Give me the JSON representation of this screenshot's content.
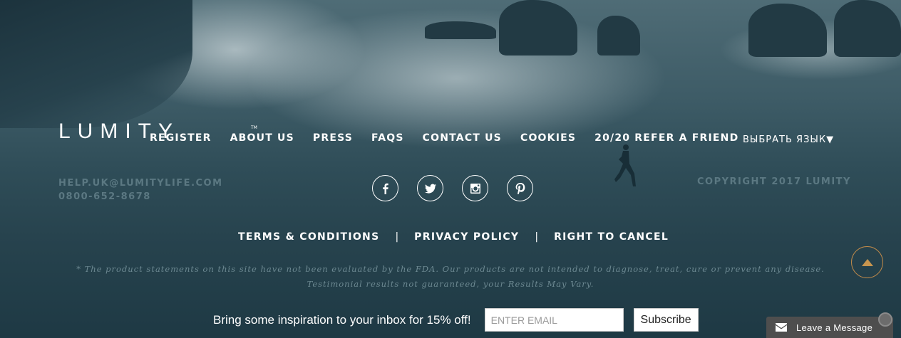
{
  "brand": {
    "logo_text": "LUMITY",
    "logo_tm": "TM"
  },
  "nav": {
    "items": [
      {
        "label": "REGISTER"
      },
      {
        "label": "ABOUT US"
      },
      {
        "label": "PRESS"
      },
      {
        "label": "FAQS"
      },
      {
        "label": "CONTACT US"
      },
      {
        "label": "COOKIES"
      },
      {
        "label": "20/20 REFER A FRIEND"
      }
    ],
    "language": "ВЫБРАТЬ ЯЗЫК▼"
  },
  "contact": {
    "email": "HELP.UK@LUMITYLIFE.COM",
    "phone": "0800-652-8678"
  },
  "copyright": "COPYRIGHT 2017 LUMITY",
  "social": [
    {
      "icon": "facebook-icon"
    },
    {
      "icon": "twitter-icon"
    },
    {
      "icon": "instagram-icon"
    },
    {
      "icon": "pinterest-icon"
    }
  ],
  "legal": {
    "terms": "TERMS & CONDITIONS",
    "separator": "|",
    "privacy": "PRIVACY POLICY",
    "cancel": "RIGHT TO CANCEL"
  },
  "disclaimer": {
    "line1": "* The product statements on this site have not been evaluated by the FDA. Our products are not intended to diagnose, treat, cure or prevent any disease.",
    "line2": "Testimonial results not guaranteed, your Results May Vary."
  },
  "newsletter": {
    "text": "Bring some inspiration to your inbox for 15% off!",
    "placeholder": "ENTER EMAIL",
    "button": "Subscribe"
  },
  "chat": {
    "label": "Leave a Message"
  },
  "colors": {
    "accent": "#c8954f",
    "muted_text": "#5b7882",
    "background": "#2f4d58"
  }
}
